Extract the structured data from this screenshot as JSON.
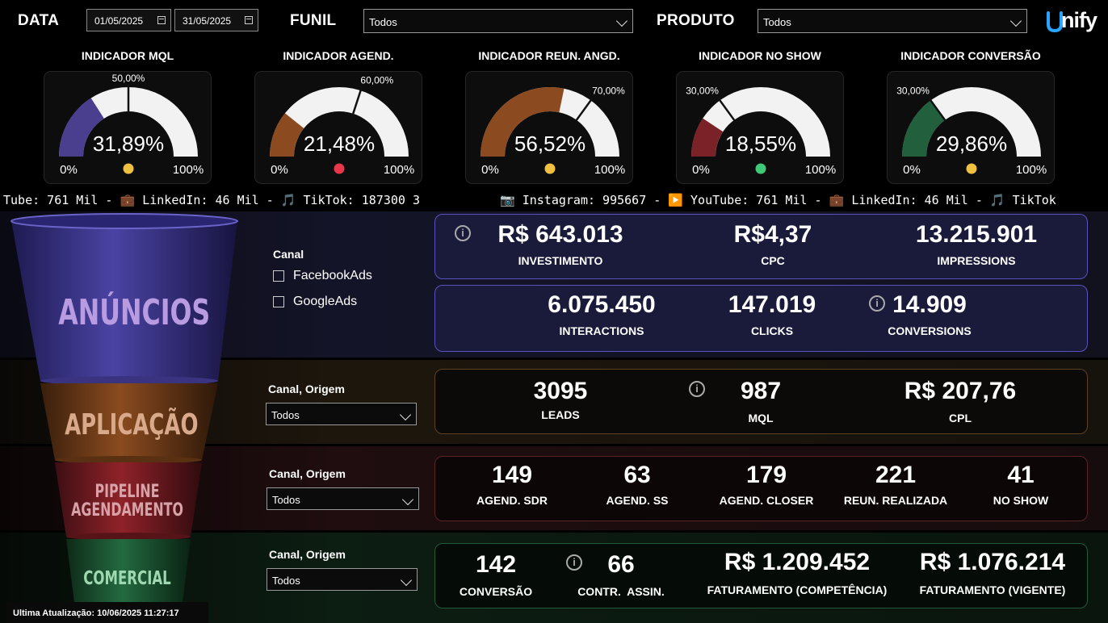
{
  "header": {
    "data_label": "DATA",
    "date_start": "01/05/2025",
    "date_end": "31/05/2025",
    "funil_label": "FUNIL",
    "funil_value": "Todos",
    "produto_label": "PRODUTO",
    "produto_value": "Todos",
    "logo_text": "nify"
  },
  "gauges": [
    {
      "title": "INDICADOR MQL",
      "value": 31.89,
      "value_text": "31,89%",
      "target": 50,
      "target_text": "50,00%",
      "min_text": "0%",
      "max_text": "100%",
      "fill_color": "#4a3f8f",
      "dot_color": "#f0c040"
    },
    {
      "title": "INDICADOR AGEND.",
      "value": 21.48,
      "value_text": "21,48%",
      "target": 60,
      "target_text": "60,00%",
      "min_text": "0%",
      "max_text": "100%",
      "fill_color": "#8b4a1f",
      "dot_color": "#e8364a"
    },
    {
      "title": "INDICADOR REUN. ANGD.",
      "value": 56.52,
      "value_text": "56,52%",
      "target": 70,
      "target_text": "70,00%",
      "min_text": "0%",
      "max_text": "100%",
      "fill_color": "#8b4a1f",
      "dot_color": "#f0c040"
    },
    {
      "title": "INDICADOR NO SHOW",
      "value": 18.55,
      "value_text": "18,55%",
      "target": 30,
      "target_text": "30,00%",
      "min_text": "0%",
      "max_text": "100%",
      "fill_color": "#7a2228",
      "dot_color": "#3ec878"
    },
    {
      "title": "INDICADOR CONVERSÃO",
      "value": 29.86,
      "value_text": "29,86%",
      "target": 30,
      "target_text": "30,00%",
      "min_text": "0%",
      "max_text": "100%",
      "fill_color": "#22603d",
      "dot_color": "#f0c040"
    }
  ],
  "ticker": {
    "left": "Tube: 761 Mil - 💼 LinkedIn: 46 Mil - 🎵 TikTok: 187300 3",
    "right": "📷 Instagram: 995667 - ▶️ YouTube: 761 Mil - 💼 LinkedIn: 46 Mil - 🎵 TikTok"
  },
  "funnel": {
    "anuncios": "ANÚNCIOS",
    "aplicacao": "APLICAÇÃO",
    "pipeline_1": "PIPELINE",
    "pipeline_2": "AGENDAMENTO",
    "comercial": "COMERCIAL"
  },
  "anuncios": {
    "filter_label": "Canal",
    "options": [
      "FacebookAds",
      "GoogleAds"
    ],
    "row1": [
      {
        "value": "R$ 643.013",
        "label": "INVESTIMENTO"
      },
      {
        "value": "R$4,37",
        "label": "CPC"
      },
      {
        "value": "13.215.901",
        "label": "IMPRESSIONS"
      }
    ],
    "row2": [
      {
        "value": "6.075.450",
        "label": "INTERACTIONS"
      },
      {
        "value": "147.019",
        "label": "CLICKS"
      },
      {
        "value": "14.909",
        "label": "CONVERSIONS"
      }
    ]
  },
  "aplicacao": {
    "filter_label": "Canal, Origem",
    "filter_value": "Todos",
    "kpis": [
      {
        "value": "3095",
        "label": "LEADS"
      },
      {
        "value": "987",
        "label": "MQL"
      },
      {
        "value": "R$ 207,76",
        "label": "CPL"
      }
    ]
  },
  "pipeline": {
    "filter_label": "Canal, Origem",
    "filter_value": "Todos",
    "kpis": [
      {
        "value": "149",
        "label": "AGEND. SDR"
      },
      {
        "value": "63",
        "label": "AGEND. SS"
      },
      {
        "value": "179",
        "label": "AGEND. CLOSER"
      },
      {
        "value": "221",
        "label": "REUN. REALIZADA"
      },
      {
        "value": "41",
        "label": "NO SHOW"
      }
    ]
  },
  "comercial": {
    "filter_label": "Canal, Origem",
    "filter_value": "Todos",
    "kpis": [
      {
        "value": "142",
        "label": "CONVERSÃO"
      },
      {
        "value": "66",
        "label": "CONTR.  ASSIN."
      },
      {
        "value": "R$ 1.209.452",
        "label": "FATURAMENTO (COMPETÊNCIA)"
      },
      {
        "value": "R$ 1.076.214",
        "label": "FATURAMENTO (VIGENTE)"
      }
    ]
  },
  "footer": {
    "last_update": "Ultima Atualização: 10/06/2025 11:27:17"
  }
}
